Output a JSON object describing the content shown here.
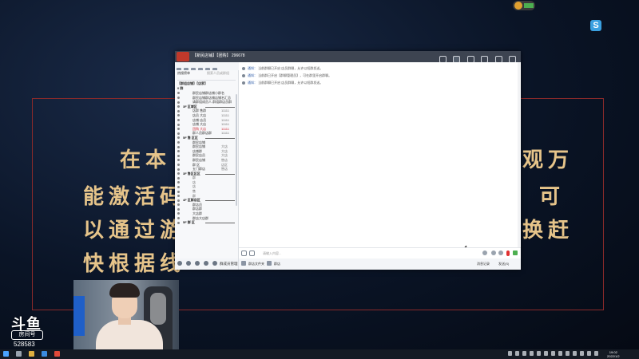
{
  "slide": {
    "lines": [
      "在本",
      "能激活码",
      "以通过游",
      "快根据线"
    ],
    "right_fragments": [
      "观万",
      "可",
      "换赶"
    ]
  },
  "stream": {
    "watermark": "斗鱼",
    "watermark_sub": "房间号",
    "room_number": "528583"
  },
  "qq_window": {
    "title": "【新民店铺】【团购】",
    "title_extra": "296678",
    "sidebar_header": "热搜榜单",
    "sidebar_hint": "搜索人员或群组",
    "sidebar_tab": "【群组店铺】【店家】",
    "group_title": "0 群",
    "rows": [
      {
        "name": "群民店铺群店铺小群名",
        "count": "",
        "type": "item"
      },
      {
        "name": "群民店铺群店铺店铺名汇总",
        "count": "",
        "type": "item"
      },
      {
        "name": "请群组成员人 群组群店员群",
        "count": "",
        "type": "item"
      },
      {
        "name": "3F 区域区",
        "count": "",
        "type": "sec"
      },
      {
        "name": "店群 售群",
        "count": "11111",
        "type": "item"
      },
      {
        "name": "店员 大店",
        "count": "11111",
        "type": "item"
      },
      {
        "name": "店铺 店员",
        "count": "11111",
        "type": "item"
      },
      {
        "name": "店铺 大店",
        "count": "11111",
        "type": "item"
      },
      {
        "name": "团购 大店",
        "count": "11111",
        "type": "red"
      },
      {
        "name": "群人员群店群",
        "count": "11111",
        "type": "item"
      },
      {
        "name": "5F 售 区区",
        "count": "",
        "type": "sec"
      },
      {
        "name": "群民店铺",
        "count": "",
        "type": "item"
      },
      {
        "name": "群民店铺",
        "count": "大店",
        "type": "item"
      },
      {
        "name": "店铺群",
        "count": "大店",
        "type": "item"
      },
      {
        "name": "群民店员",
        "count": "大店",
        "type": "item"
      },
      {
        "name": "群民店铺",
        "count": "售店",
        "type": "item"
      },
      {
        "name": "群 区",
        "count": "店区",
        "type": "item"
      },
      {
        "name": "五门群店",
        "count": "售店",
        "type": "item"
      },
      {
        "name": "3F 售区区区",
        "count": "",
        "type": "sec"
      },
      {
        "name": "群",
        "count": "",
        "type": "gray"
      },
      {
        "name": "店",
        "count": "",
        "type": "gray"
      },
      {
        "name": "店",
        "count": "",
        "type": "gray"
      },
      {
        "name": "售",
        "count": "",
        "type": "gray"
      },
      {
        "name": "群",
        "count": "",
        "type": "gray"
      },
      {
        "name": "4F 区群店区",
        "count": "",
        "type": "sec"
      },
      {
        "name": "群店员",
        "count": "",
        "type": "item"
      },
      {
        "name": "群店群",
        "count": "",
        "type": "item"
      },
      {
        "name": "大店群",
        "count": "",
        "type": "item"
      },
      {
        "name": "群店大店群",
        "count": "",
        "type": "item"
      },
      {
        "name": "5F 群 区",
        "count": "",
        "type": "sec"
      }
    ],
    "messages": [
      {
        "link": "通知：",
        "text": "当前群聊已开启 店员群聊，允许以短群发送。"
      },
      {
        "link": "通知：",
        "text": "当前群已开启【群聊管理员】，可在群里开启群聊。"
      },
      {
        "link": "通知：",
        "text": "当前群聊已开启 店员群聊，允许以短群发送。"
      }
    ],
    "input_placeholder": "请输入内容...",
    "sidebar_bottom": {
      "a": "群成员管理",
      "b": "群店"
    },
    "bottom_bar": {
      "a": "群店文件夹",
      "b": "群店",
      "c": "消息记录",
      "d": "发送(S)"
    }
  },
  "taskbar": {
    "time": "19:02",
    "date": "2022/1/2"
  }
}
